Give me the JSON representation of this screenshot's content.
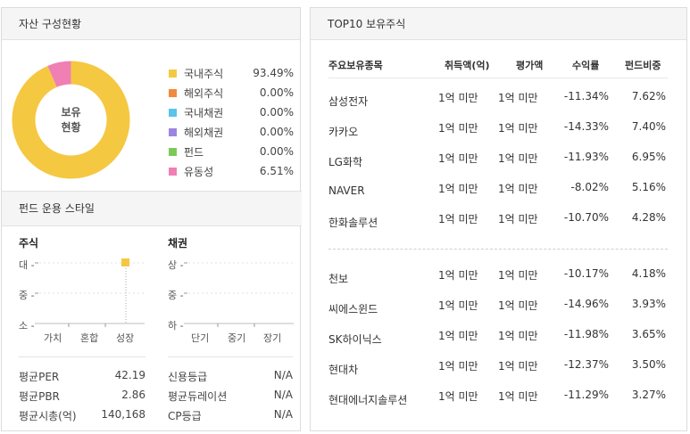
{
  "top_mark": "",
  "asset": {
    "title": "자산 구성현황",
    "donut_center": [
      "보유",
      "현황"
    ],
    "legend": [
      {
        "name": "국내주식",
        "value": "93.49%",
        "color": "#f5c842"
      },
      {
        "name": "해외주식",
        "value": "0.00%",
        "color": "#f08a3c"
      },
      {
        "name": "국내채권",
        "value": "0.00%",
        "color": "#5bc4ea"
      },
      {
        "name": "해외채권",
        "value": "0.00%",
        "color": "#9c85e0"
      },
      {
        "name": "펀드",
        "value": "0.00%",
        "color": "#7dc85a"
      },
      {
        "name": "유동성",
        "value": "6.51%",
        "color": "#f07fb4"
      }
    ],
    "slices": [
      93.49,
      6.51
    ]
  },
  "style": {
    "title": "펀드 운용 스타일",
    "stock": {
      "title": "주식",
      "y_labels": [
        "대",
        "중",
        "소"
      ],
      "x_labels": [
        "가치",
        "혼합",
        "성장"
      ],
      "marker": {
        "x": "성장",
        "y": "대"
      }
    },
    "bond": {
      "title": "채권",
      "y_labels": [
        "상",
        "중",
        "하"
      ],
      "x_labels": [
        "단기",
        "중기",
        "장기"
      ]
    },
    "metrics_left": [
      {
        "label": "평균PER",
        "value": "42.19"
      },
      {
        "label": "평균PBR",
        "value": "2.86"
      },
      {
        "label": "평균시총(억)",
        "value": "140,168"
      }
    ],
    "metrics_right": [
      {
        "label": "신용등급",
        "value": "N/A"
      },
      {
        "label": "평균듀레이션",
        "value": "N/A"
      },
      {
        "label": "CP등급",
        "value": "N/A"
      }
    ]
  },
  "top10": {
    "title": "TOP10 보유주식",
    "headers": [
      "주요보유종목",
      "취득액(억)",
      "평가액",
      "수익률",
      "펀드비중"
    ],
    "rows": [
      {
        "name": "삼성전자",
        "acq": "1억 미만",
        "eval": "1억 미만",
        "ret": "-11.34%",
        "weight": "7.62%"
      },
      {
        "name": "카카오",
        "acq": "1억 미만",
        "eval": "1억 미만",
        "ret": "-14.33%",
        "weight": "7.40%"
      },
      {
        "name": "LG화학",
        "acq": "1억 미만",
        "eval": "1억 미만",
        "ret": "-11.93%",
        "weight": "6.95%"
      },
      {
        "name": "NAVER",
        "acq": "1억 미만",
        "eval": "1억 미만",
        "ret": "-8.02%",
        "weight": "5.16%"
      },
      {
        "name": "한화솔루션",
        "acq": "1억 미만",
        "eval": "1억 미만",
        "ret": "-10.70%",
        "weight": "4.28%"
      },
      {
        "name": "천보",
        "acq": "1억 미만",
        "eval": "1억 미만",
        "ret": "-10.17%",
        "weight": "4.18%"
      },
      {
        "name": "씨에스윈드",
        "acq": "1억 미만",
        "eval": "1억 미만",
        "ret": "-14.96%",
        "weight": "3.93%"
      },
      {
        "name": "SK하이닉스",
        "acq": "1억 미만",
        "eval": "1억 미만",
        "ret": "-11.98%",
        "weight": "3.65%"
      },
      {
        "name": "현대차",
        "acq": "1억 미만",
        "eval": "1억 미만",
        "ret": "-12.37%",
        "weight": "3.50%"
      },
      {
        "name": "현대에너지솔루션",
        "acq": "1억 미만",
        "eval": "1억 미만",
        "ret": "-11.29%",
        "weight": "3.27%"
      }
    ]
  }
}
